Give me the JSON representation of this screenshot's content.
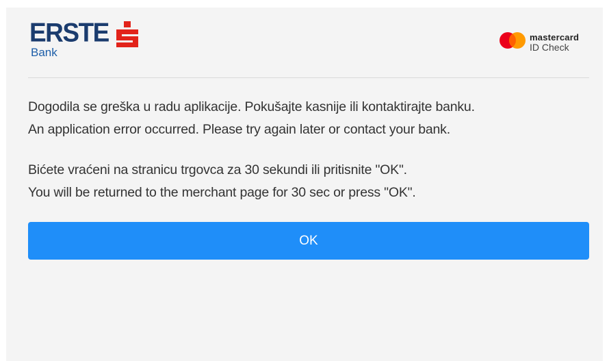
{
  "header": {
    "bank_logo": {
      "word": "ERSTE",
      "sub": "Bank",
      "brand_color": "#1b3c6e",
      "accent_color": "#e2231a"
    },
    "card_logo": {
      "word": "mastercard",
      "sub": "ID Check",
      "red": "#eb001b",
      "orange": "#ff9a00"
    }
  },
  "messages": {
    "error_hr": "Dogodila se greška u radu aplikacije. Pokušajte kasnije ili kontaktirajte banku.",
    "error_en": "An application error occurred. Please try again later or contact your bank.",
    "return_hr": "Bićete vraćeni na stranicu trgovca za 30 sekundi ili pritisnite \"OK\".",
    "return_en": "You will be returned to the merchant page for 30 sec or press \"OK\"."
  },
  "actions": {
    "ok_label": "OK",
    "button_color": "#1f8ef9"
  }
}
